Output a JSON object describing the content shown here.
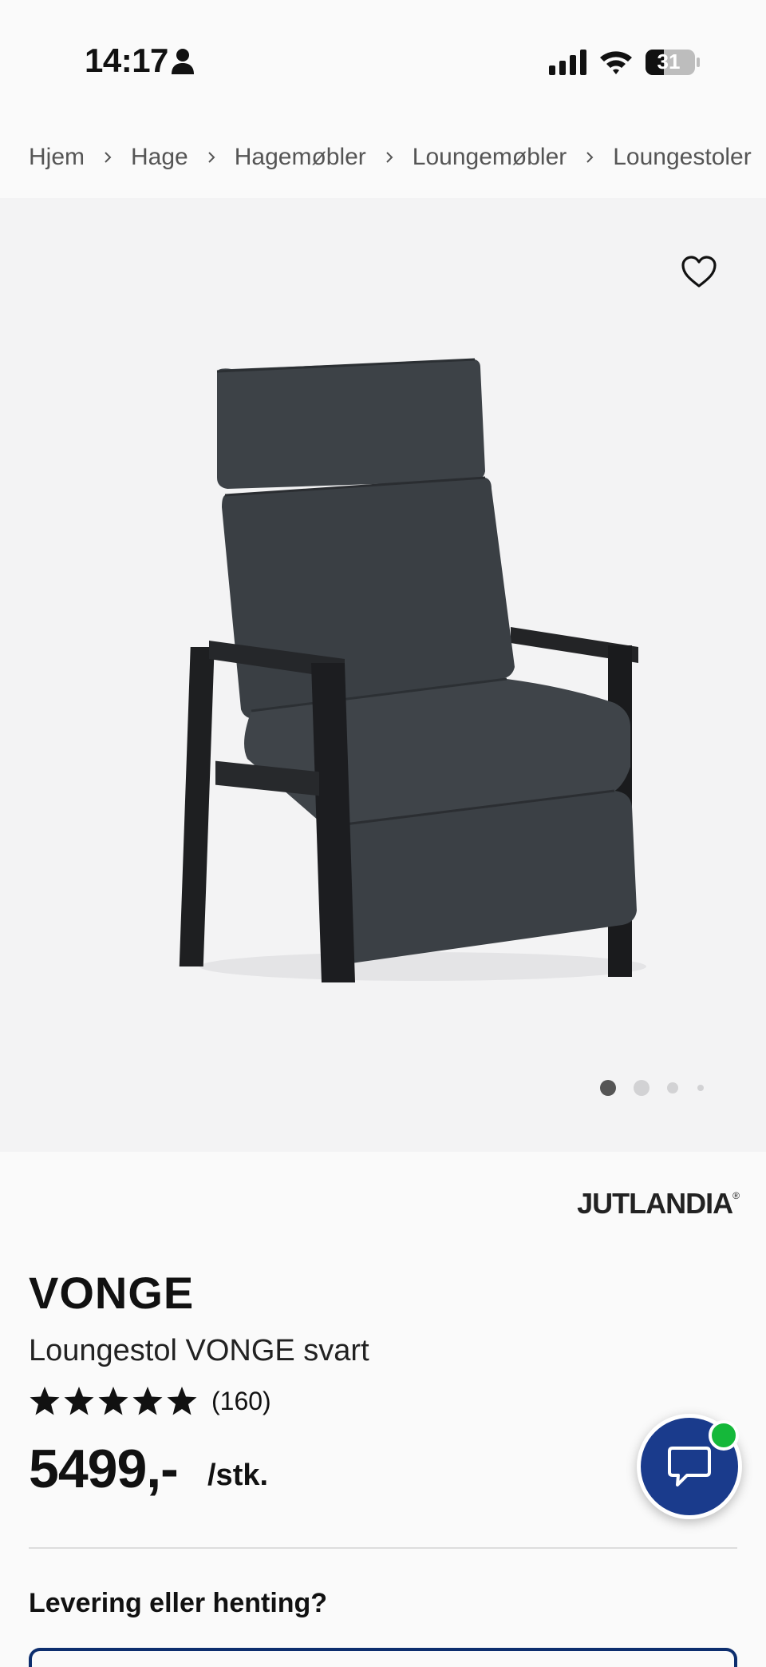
{
  "status_bar": {
    "time": "14:17",
    "battery": "31"
  },
  "breadcrumb": {
    "items": [
      "Hjem",
      "Hage",
      "Hagemøbler",
      "Loungemøbler",
      "Loungestoler"
    ]
  },
  "gallery": {
    "image_count": 4,
    "active_index": 0
  },
  "product": {
    "brand": "JUTLANDIA",
    "brand_mark": "®",
    "name": "VONGE",
    "description": "Loungestol VONGE svart",
    "rating_stars": 5,
    "rating_count": "(160)",
    "price": "5499,-",
    "unit": "/stk."
  },
  "delivery": {
    "heading": "Levering eller henting?"
  },
  "colors": {
    "accent": "#0d2e6e",
    "chat_button": "#1a3b8c",
    "online": "#15b83a"
  }
}
